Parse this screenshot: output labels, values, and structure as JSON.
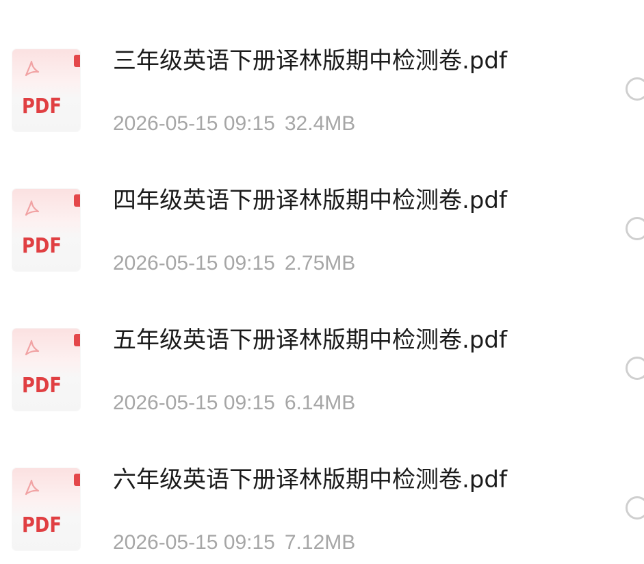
{
  "files": [
    {
      "name": "三年级英语下册译林版期中检测卷.pdf",
      "date": "2026-05-15 09:15",
      "size": "32.4MB",
      "thumb_label": "PDF"
    },
    {
      "name": "四年级英语下册译林版期中检测卷.pdf",
      "date": "2026-05-15 09:15",
      "size": "2.75MB",
      "thumb_label": "PDF"
    },
    {
      "name": "五年级英语下册译林版期中检测卷.pdf",
      "date": "2026-05-15 09:15",
      "size": "6.14MB",
      "thumb_label": "PDF"
    },
    {
      "name": "六年级英语下册译林版期中检测卷.pdf",
      "date": "2026-05-15 09:15",
      "size": "7.12MB",
      "thumb_label": "PDF"
    }
  ],
  "colors": {
    "pdf_red": "#e03f42",
    "meta_gray": "#a6a6a6",
    "title_black": "#1b1b1b"
  }
}
